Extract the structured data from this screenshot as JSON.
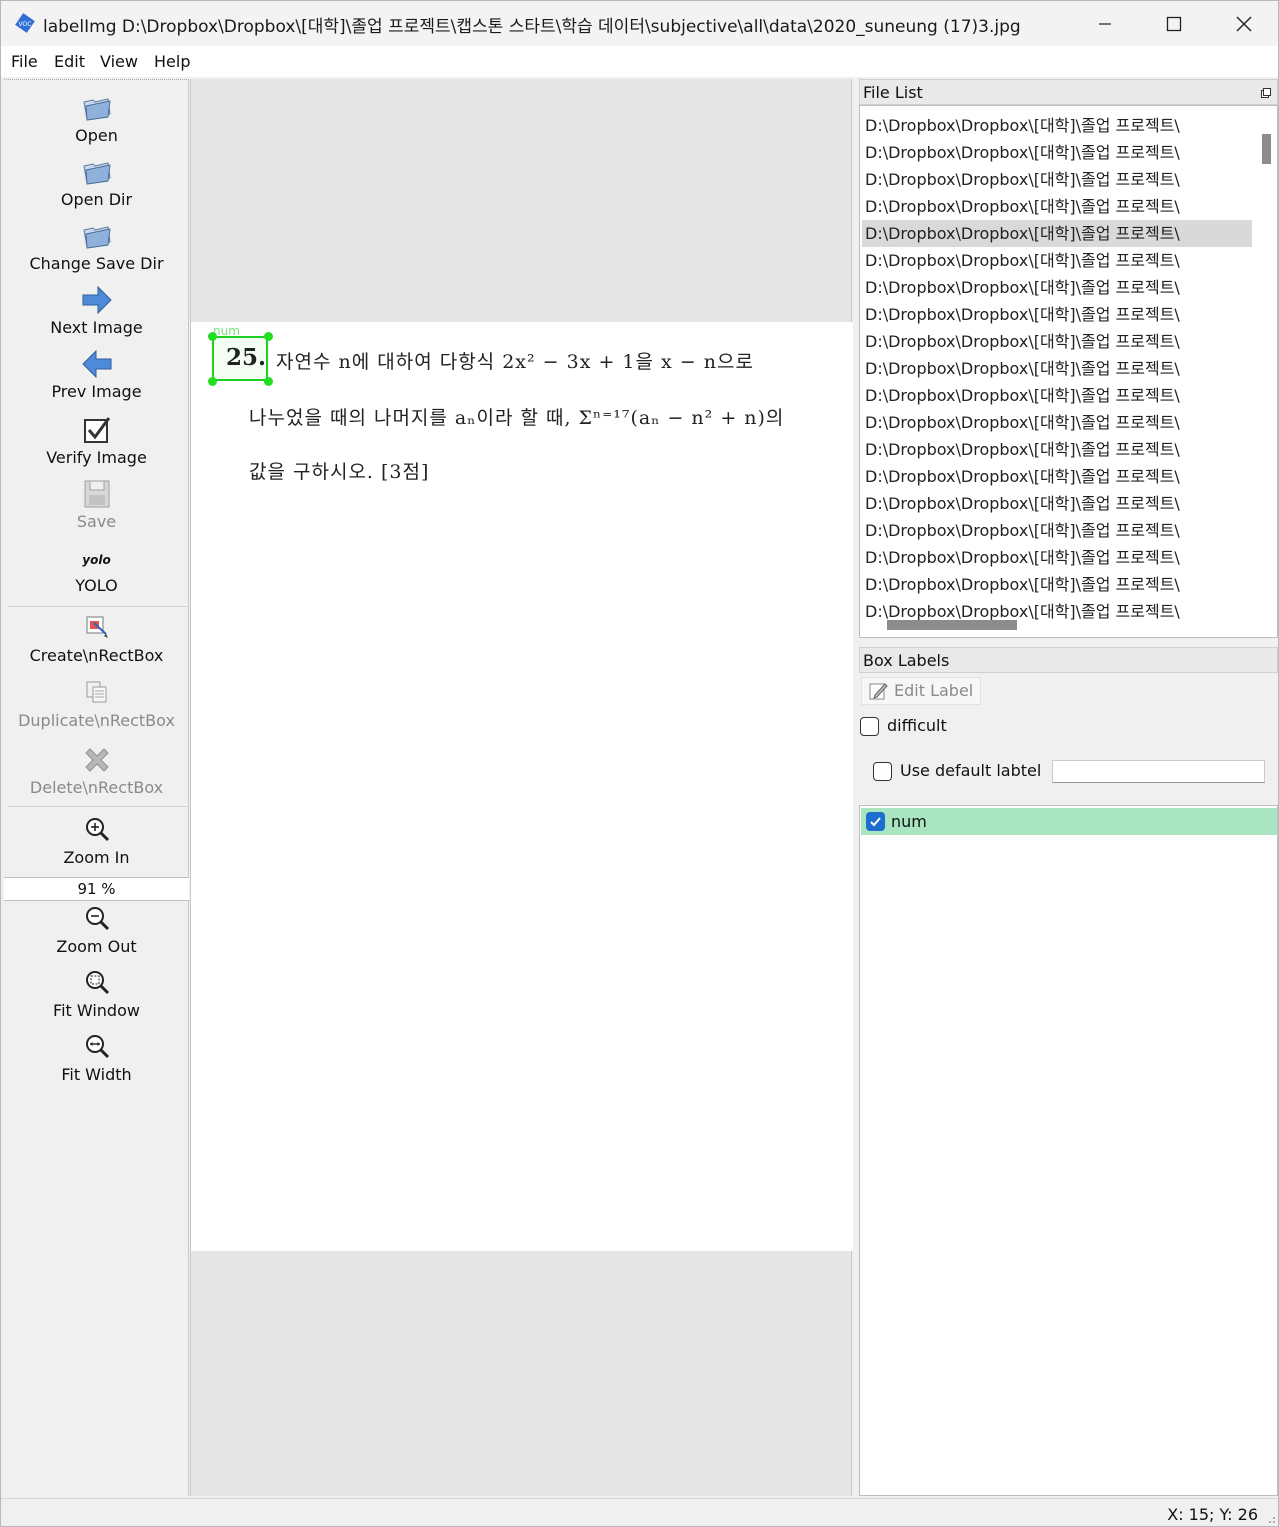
{
  "window": {
    "title": "labelImg D:\\Dropbox\\Dropbox\\[대학]\\졸업 프로젝트\\캡스톤 스타트\\학습 데이터\\subjective\\all\\data\\2020_suneung (17)3.jpg",
    "app_icon": "labelimg-tag-icon"
  },
  "menu": [
    "File",
    "Edit",
    "View",
    "Help"
  ],
  "toolbar": {
    "open": "Open",
    "open_dir": "Open Dir",
    "change_save_dir": "Change Save Dir",
    "next_image": "Next Image",
    "prev_image": "Prev Image",
    "verify_image": "Verify Image",
    "save": "Save",
    "yolo_icon_text": "yolo",
    "yolo": "YOLO",
    "create_rect": "Create\\nRectBox",
    "duplicate_rect": "Duplicate\\nRectBox",
    "delete_rect": "Delete\\nRectBox",
    "zoom_in": "Zoom In",
    "zoom_value": "91 %",
    "zoom_out": "Zoom Out",
    "fit_window": "Fit Window",
    "fit_width": "Fit Width"
  },
  "canvas": {
    "bbox_label": "num",
    "question_number": "25.",
    "line1": "자연수 n에 대하여 다항식 2x² − 3x + 1을 x − n으로",
    "line2": "나누었을 때의 나머지를 aₙ이라 할 때, Σⁿ⁼¹⁷(aₙ − n² + n)의",
    "line3": "값을 구하시오. [3점]"
  },
  "file_list": {
    "title": "File List",
    "item_text": "D:\\Dropbox\\Dropbox\\[대학]\\졸업 프로젝트\\",
    "selected_index": 4,
    "count": 19
  },
  "box_labels": {
    "title": "Box Labels",
    "edit_label": "Edit Label",
    "difficult": "difficult",
    "use_default": "Use default labtel",
    "default_value": "",
    "labels": [
      {
        "name": "num",
        "checked": true
      }
    ]
  },
  "status": {
    "coords": "X: 15; Y: 26"
  },
  "colors": {
    "bbox": "#20d020",
    "label_row": "#a9e5c0",
    "check_blue": "#1d6fcf"
  }
}
